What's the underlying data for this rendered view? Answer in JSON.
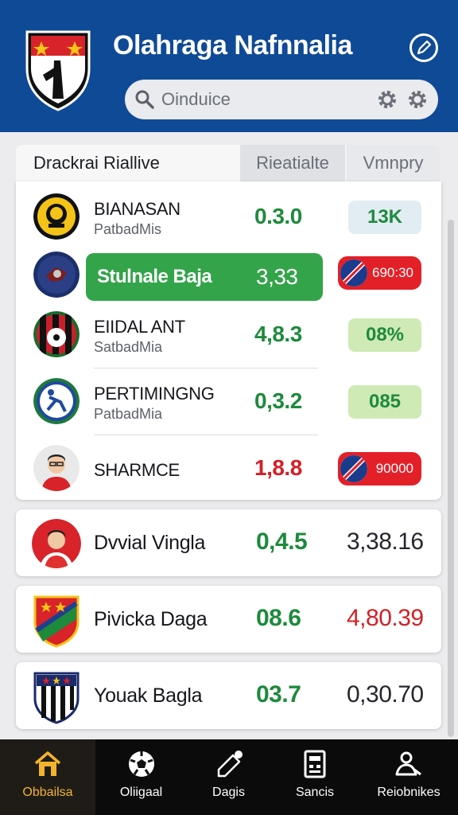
{
  "header": {
    "title": "Olahraga Nafnnalia",
    "search_placeholder": "Oinduice"
  },
  "tabs": [
    {
      "label": "Drackrai Riallive"
    },
    {
      "label": "Rieatialte"
    },
    {
      "label": "Vmnpry"
    }
  ],
  "list": [
    {
      "name": "BIANASAN",
      "sub": "PatbadMis",
      "value": "0.3.0",
      "value_color": "green",
      "badge": "13K",
      "badge_style": "blue"
    },
    {
      "name": "Stulnale Baja",
      "sub": "",
      "value": "3,33",
      "value_color": "white",
      "badge": "690:30",
      "badge_style": "redpill",
      "highlighted": true
    },
    {
      "name": "EIIDAL ANT",
      "sub": "SatbadMia",
      "value": "4,8.3",
      "value_color": "green",
      "badge": "08%",
      "badge_style": "lg"
    },
    {
      "name": "PERTIMINGNG",
      "sub": "PatbadMia",
      "value": "0,3.2",
      "value_color": "green",
      "badge": "085",
      "badge_style": "lg"
    },
    {
      "name": "SHARMCE",
      "sub": "",
      "value": "1,8.8",
      "value_color": "red",
      "badge": "90000",
      "badge_style": "redpill"
    }
  ],
  "cards": [
    {
      "name": "Dvvial Vingla",
      "value": "0,4.5",
      "total": "3,38.16",
      "total_color": "dark"
    },
    {
      "name": "Pivicka Daga",
      "value": "08.6",
      "total": "4,80.39",
      "total_color": "red"
    },
    {
      "name": "Youak Bagla",
      "value": "03.7",
      "total": "0,30.70",
      "total_color": "dark"
    }
  ],
  "bottom_nav": [
    {
      "label": "Obbailsa",
      "icon": "home-icon",
      "active": true
    },
    {
      "label": "Oliigaal",
      "icon": "soccer-ball-icon"
    },
    {
      "label": "Dagis",
      "icon": "edit-icon"
    },
    {
      "label": "Sancis",
      "icon": "calculator-icon"
    },
    {
      "label": "Reiobnikes",
      "icon": "profile-icon"
    }
  ],
  "colors": {
    "header_bg": "#0f4a96",
    "green": "#1e8a3c",
    "red": "#d42026",
    "highlight": "#34a44a",
    "nav_active": "#f2b42a"
  }
}
